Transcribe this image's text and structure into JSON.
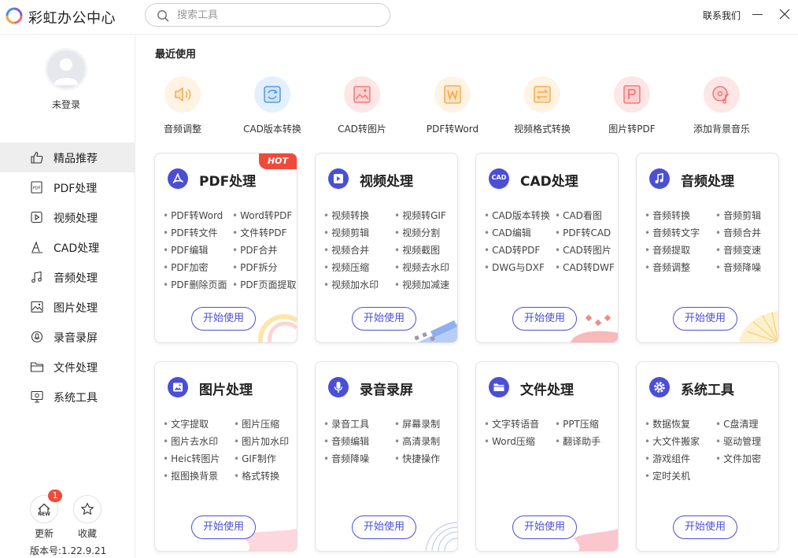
{
  "app": {
    "title": "彩虹办公中心"
  },
  "search": {
    "placeholder": "搜索工具"
  },
  "header": {
    "contact": "联系我们"
  },
  "user": {
    "status": "未登录"
  },
  "sidebar": {
    "items": [
      {
        "label": "精品推荐",
        "icon": "thumbs-up-icon",
        "active": true
      },
      {
        "label": "PDF处理",
        "icon": "pdf-icon"
      },
      {
        "label": "视频处理",
        "icon": "video-icon"
      },
      {
        "label": "CAD处理",
        "icon": "cad-icon"
      },
      {
        "label": "音频处理",
        "icon": "music-icon"
      },
      {
        "label": "图片处理",
        "icon": "image-icon"
      },
      {
        "label": "录音录屏",
        "icon": "record-icon"
      },
      {
        "label": "文件处理",
        "icon": "folder-icon"
      },
      {
        "label": "系统工具",
        "icon": "system-icon"
      }
    ],
    "update_label": "更新",
    "update_badge": "1",
    "update_icon_text": "NEW",
    "favorite_label": "收藏",
    "version": "版本号:1.22.9.21"
  },
  "recent": {
    "title": "最近使用",
    "items": [
      {
        "label": "音频调整",
        "icon": "audio-adjust-icon",
        "color": "#f5a340"
      },
      {
        "label": "CAD版本转换",
        "icon": "cad-convert-icon",
        "color": "#3a8ee6"
      },
      {
        "label": "CAD转图片",
        "icon": "cad-image-icon",
        "color": "#f06a6a"
      },
      {
        "label": "PDF转Word",
        "icon": "pdf-word-icon",
        "color": "#f5a340"
      },
      {
        "label": "视频格式转换",
        "icon": "video-convert-icon",
        "color": "#f5a340"
      },
      {
        "label": "图片转PDF",
        "icon": "image-pdf-icon",
        "color": "#f06a6a"
      },
      {
        "label": "添加背景音乐",
        "icon": "bg-music-icon",
        "color": "#f06a6a"
      }
    ]
  },
  "cards": [
    {
      "title": "PDF处理",
      "hot": "HOT",
      "icon": "pdf-icon",
      "items": [
        "PDF转Word",
        "Word转PDF",
        "PDF转文件",
        "文件转PDF",
        "PDF编辑",
        "PDF合并",
        "PDF加密",
        "PDF拆分",
        "PDF删除页面",
        "PDF页面提取"
      ],
      "button": "开始使用"
    },
    {
      "title": "视频处理",
      "icon": "video-icon",
      "items": [
        "视频转换",
        "视频转GIF",
        "视频剪辑",
        "视频分割",
        "视频合并",
        "视频截图",
        "视频压缩",
        "视频去水印",
        "视频加水印",
        "视频加减速"
      ],
      "button": "开始使用"
    },
    {
      "title": "CAD处理",
      "icon": "cad-icon",
      "icon_text": "CAD",
      "items": [
        "CAD版本转换",
        "CAD看图",
        "CAD编辑",
        "PDF转CAD",
        "CAD转PDF",
        "CAD转图片",
        "DWG与DXF",
        "CAD转DWF"
      ],
      "button": "开始使用"
    },
    {
      "title": "音频处理",
      "icon": "music-icon",
      "items": [
        "音频转换",
        "音频剪辑",
        "音频转文字",
        "音频合并",
        "音频提取",
        "音频变速",
        "音频调整",
        "音频降噪"
      ],
      "button": "开始使用"
    },
    {
      "title": "图片处理",
      "icon": "image-icon",
      "items": [
        "文字提取",
        "图片压缩",
        "图片去水印",
        "图片加水印",
        "Heic转图片",
        "GIF制作",
        "抠图换背景",
        "格式转换"
      ],
      "button": "开始使用"
    },
    {
      "title": "录音录屏",
      "icon": "microphone-icon",
      "items": [
        "录音工具",
        "屏幕录制",
        "音频编辑",
        "高清录制",
        "音频降噪",
        "快捷操作"
      ],
      "button": "开始使用"
    },
    {
      "title": "文件处理",
      "icon": "folder-icon",
      "items": [
        "文字转语音",
        "PPT压缩",
        "Word压缩",
        "翻译助手"
      ],
      "button": "开始使用"
    },
    {
      "title": "系统工具",
      "icon": "gear-icon",
      "items": [
        "数据恢复",
        "C盘清理",
        "大文件搬家",
        "驱动管理",
        "游戏组件",
        "文件加密",
        "定时关机"
      ],
      "button": "开始使用"
    }
  ],
  "colors": {
    "accent": "#4b4fd4",
    "hot": "#f04a3a",
    "badge": "#f04a3a"
  }
}
